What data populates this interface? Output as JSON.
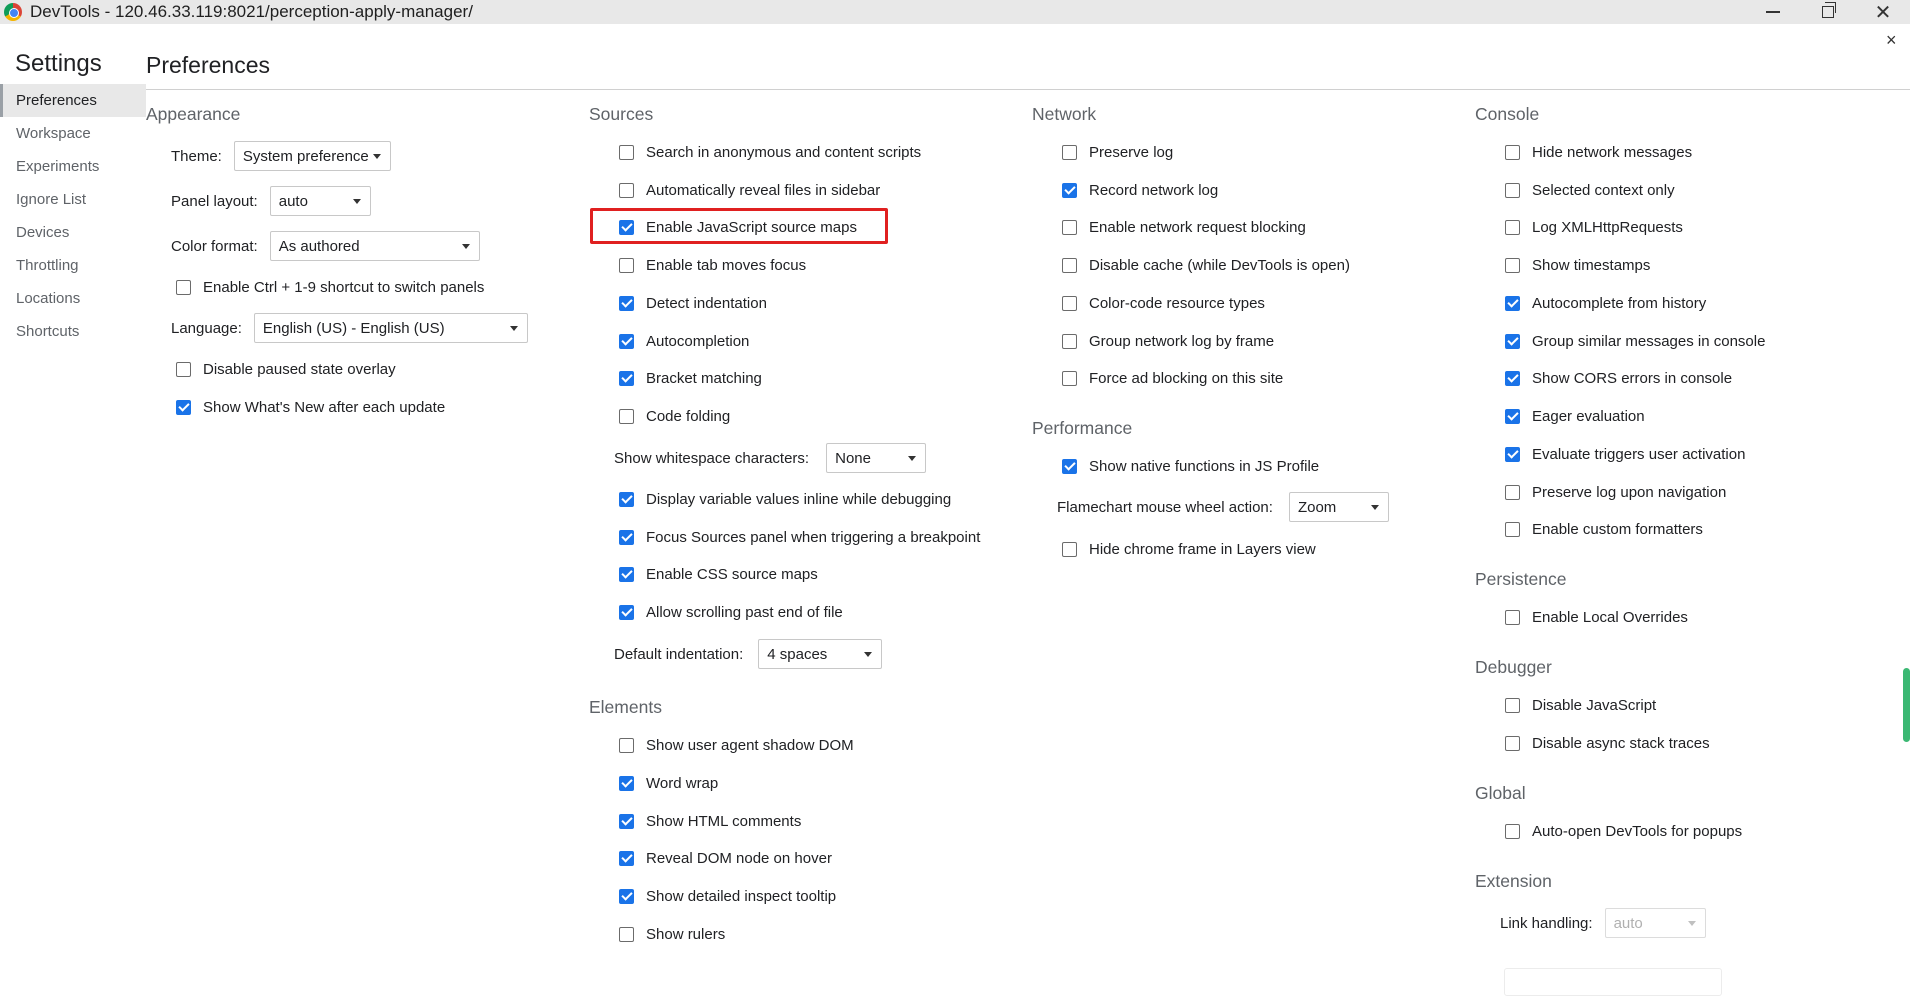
{
  "window": {
    "title": "DevTools - 120.46.33.119:8021/perception-apply-manager/",
    "close_glyph": "✕",
    "panel_close_glyph": "×"
  },
  "sidebar": {
    "heading": "Settings",
    "items": [
      {
        "label": "Preferences",
        "active": true
      },
      {
        "label": "Workspace"
      },
      {
        "label": "Experiments"
      },
      {
        "label": "Ignore List"
      },
      {
        "label": "Devices"
      },
      {
        "label": "Throttling"
      },
      {
        "label": "Locations"
      },
      {
        "label": "Shortcuts"
      }
    ]
  },
  "main": {
    "title": "Preferences"
  },
  "appearance": {
    "title": "Appearance",
    "theme": {
      "label": "Theme:",
      "value": "System preference"
    },
    "panel_layout": {
      "label": "Panel layout:",
      "value": "auto"
    },
    "color_format": {
      "label": "Color format:",
      "value": "As authored"
    },
    "ctrl_shortcut": {
      "label": "Enable Ctrl + 1-9 shortcut to switch panels",
      "checked": false
    },
    "language": {
      "label": "Language:",
      "value": "English (US) - English (US)"
    },
    "paused_overlay": {
      "label": "Disable paused state overlay",
      "checked": false
    },
    "whats_new": {
      "label": "Show What's New after each update",
      "checked": true
    }
  },
  "sources": {
    "title": "Sources",
    "items": [
      {
        "label": "Search in anonymous and content scripts",
        "checked": false
      },
      {
        "label": "Automatically reveal files in sidebar",
        "checked": false
      },
      {
        "label": "Enable JavaScript source maps",
        "checked": true
      },
      {
        "label": "Enable tab moves focus",
        "checked": false
      },
      {
        "label": "Detect indentation",
        "checked": true
      },
      {
        "label": "Autocompletion",
        "checked": true
      },
      {
        "label": "Bracket matching",
        "checked": true
      },
      {
        "label": "Code folding",
        "checked": false
      }
    ],
    "whitespace": {
      "label": "Show whitespace characters:",
      "value": "None"
    },
    "items2": [
      {
        "label": "Display variable values inline while debugging",
        "checked": true
      },
      {
        "label": "Focus Sources panel when triggering a breakpoint",
        "checked": true
      },
      {
        "label": "Enable CSS source maps",
        "checked": true
      },
      {
        "label": "Allow scrolling past end of file",
        "checked": true
      }
    ],
    "indentation": {
      "label": "Default indentation:",
      "value": "4 spaces"
    }
  },
  "elements": {
    "title": "Elements",
    "items": [
      {
        "label": "Show user agent shadow DOM",
        "checked": false
      },
      {
        "label": "Word wrap",
        "checked": true
      },
      {
        "label": "Show HTML comments",
        "checked": true
      },
      {
        "label": "Reveal DOM node on hover",
        "checked": true
      },
      {
        "label": "Show detailed inspect tooltip",
        "checked": true
      },
      {
        "label": "Show rulers",
        "checked": false
      }
    ]
  },
  "network": {
    "title": "Network",
    "items": [
      {
        "label": "Preserve log",
        "checked": false
      },
      {
        "label": "Record network log",
        "checked": true
      },
      {
        "label": "Enable network request blocking",
        "checked": false
      },
      {
        "label": "Disable cache (while DevTools is open)",
        "checked": false
      },
      {
        "label": "Color-code resource types",
        "checked": false
      },
      {
        "label": "Group network log by frame",
        "checked": false
      },
      {
        "label": "Force ad blocking on this site",
        "checked": false
      }
    ]
  },
  "performance": {
    "title": "Performance",
    "native_functions": {
      "label": "Show native functions in JS Profile",
      "checked": true
    },
    "flamechart": {
      "label": "Flamechart mouse wheel action:",
      "value": "Zoom"
    },
    "chrome_frame": {
      "label": "Hide chrome frame in Layers view",
      "checked": false
    }
  },
  "console": {
    "title": "Console",
    "items": [
      {
        "label": "Hide network messages",
        "checked": false
      },
      {
        "label": "Selected context only",
        "checked": false
      },
      {
        "label": "Log XMLHttpRequests",
        "checked": false
      },
      {
        "label": "Show timestamps",
        "checked": false
      },
      {
        "label": "Autocomplete from history",
        "checked": true
      },
      {
        "label": "Group similar messages in console",
        "checked": true
      },
      {
        "label": "Show CORS errors in console",
        "checked": true
      },
      {
        "label": "Eager evaluation",
        "checked": true
      },
      {
        "label": "Evaluate triggers user activation",
        "checked": true
      },
      {
        "label": "Preserve log upon navigation",
        "checked": false
      },
      {
        "label": "Enable custom formatters",
        "checked": false
      }
    ]
  },
  "persistence": {
    "title": "Persistence",
    "local_overrides": {
      "label": "Enable Local Overrides",
      "checked": false
    }
  },
  "debugger": {
    "title": "Debugger",
    "items": [
      {
        "label": "Disable JavaScript",
        "checked": false
      },
      {
        "label": "Disable async stack traces",
        "checked": false
      }
    ]
  },
  "global": {
    "title": "Global",
    "auto_open": {
      "label": "Auto-open DevTools for popups",
      "checked": false
    }
  },
  "extension": {
    "title": "Extension",
    "link_handling": {
      "label": "Link handling:",
      "value": "auto",
      "disabled": true
    }
  },
  "colors": {
    "accent": "#1a73e8",
    "highlight_border": "#e02020",
    "scrollbar_thumb": "#3bb873"
  }
}
